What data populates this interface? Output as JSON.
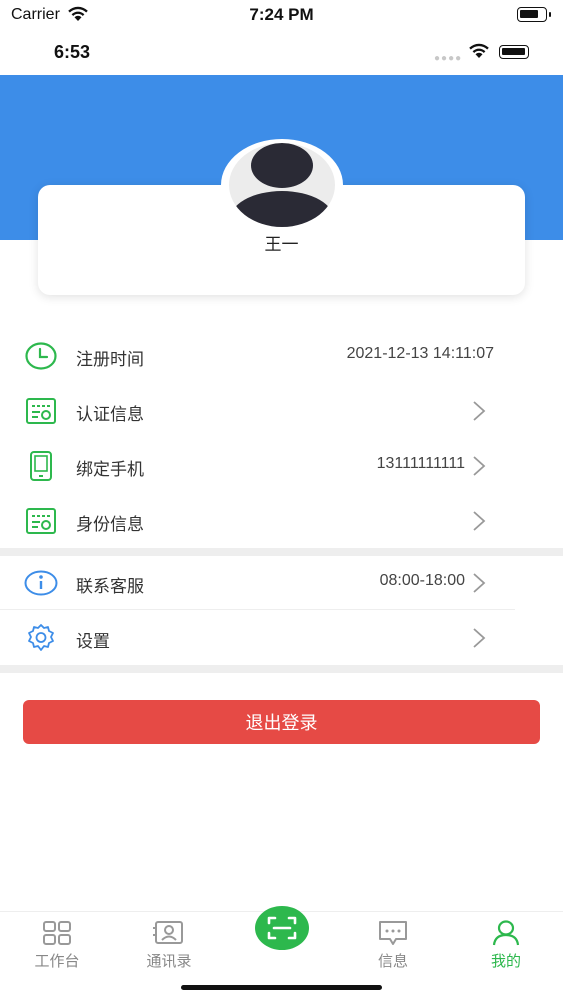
{
  "outer_status": {
    "carrier": "Carrier",
    "time": "7:24 PM"
  },
  "inner_status": {
    "time": "6:53"
  },
  "profile": {
    "name": "王一"
  },
  "info_list": [
    {
      "label": "注册时间",
      "value": "2021-12-13 14:11:07",
      "icon": "clock-icon"
    },
    {
      "label": "认证信息",
      "value": "",
      "icon": "certificate-icon"
    },
    {
      "label": "绑定手机",
      "value": "13111111111",
      "icon": "phone-icon"
    },
    {
      "label": "身份信息",
      "value": "",
      "icon": "id-card-icon"
    }
  ],
  "service_list": [
    {
      "label": "联系客服",
      "value": "08:00-18:00",
      "icon": "info-icon"
    },
    {
      "label": "设置",
      "value": "",
      "icon": "gear-icon"
    }
  ],
  "logout_label": "退出登录",
  "tabs": [
    {
      "label": "工作台",
      "icon": "grid-icon",
      "active": false
    },
    {
      "label": "通讯录",
      "icon": "contacts-icon",
      "active": false
    },
    {
      "label": "",
      "icon": "scan-icon",
      "active": false
    },
    {
      "label": "信息",
      "icon": "message-icon",
      "active": false
    },
    {
      "label": "我的",
      "icon": "person-icon",
      "active": true
    }
  ],
  "colors": {
    "header_blue": "#3d8de8",
    "accent_green": "#2db84d",
    "logout_red": "#e64a45",
    "info_blue": "#3d8de8"
  }
}
